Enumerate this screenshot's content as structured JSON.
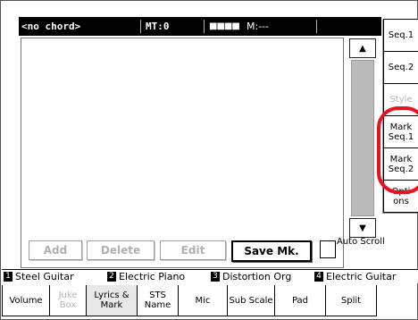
{
  "status": {
    "chord": "<no chord>",
    "mt": "MT:0",
    "bars": "■■■■",
    "measure": "M:---"
  },
  "scroll": {
    "up_glyph": "▲",
    "down_glyph": "▼"
  },
  "right_tabs": [
    {
      "label": "Seq.1"
    },
    {
      "label": "Seq.2"
    },
    {
      "label": "Style"
    },
    {
      "label": "Mark Seq.1"
    },
    {
      "label": "Mark Seq.2"
    },
    {
      "label": "Opti ons"
    }
  ],
  "actions": {
    "add": "Add",
    "delete": "Delete",
    "edit": "Edit",
    "save": "Save Mk.",
    "auto_scroll": "Auto Scroll"
  },
  "tracks": [
    {
      "num": "1",
      "name": "Steel Guitar"
    },
    {
      "num": "2",
      "name": "Electric Piano"
    },
    {
      "num": "3",
      "name": "Distortion Org"
    },
    {
      "num": "4",
      "name": "Electric Guitar"
    }
  ],
  "bottom_tabs": [
    {
      "label": "Volume"
    },
    {
      "label": "Juke Box"
    },
    {
      "label": "Lyrics & Mark"
    },
    {
      "label": "STS Name"
    },
    {
      "label": "Mic"
    },
    {
      "label": "Sub Scale"
    },
    {
      "label": "Pad"
    },
    {
      "label": "Split"
    }
  ]
}
